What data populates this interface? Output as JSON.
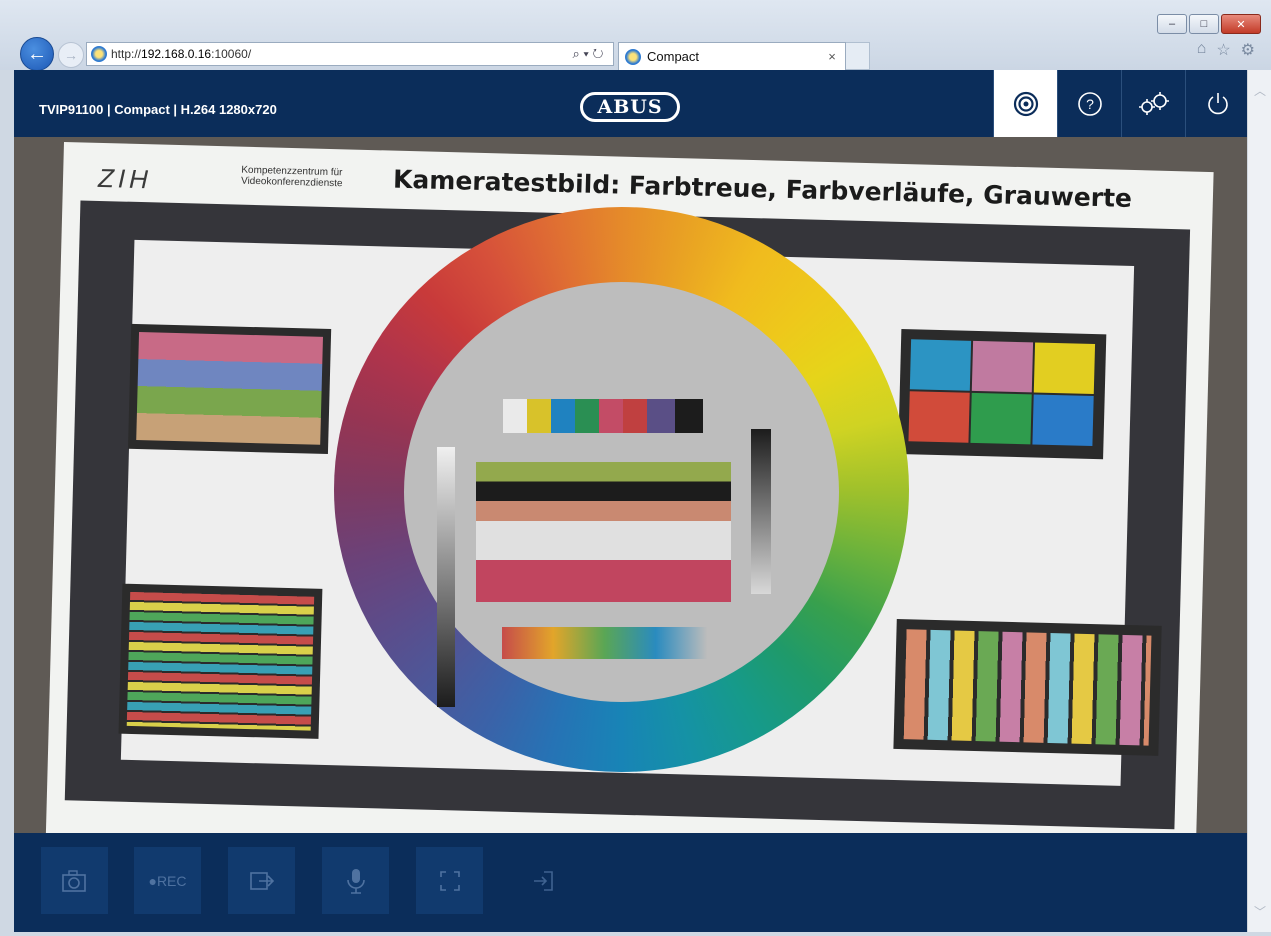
{
  "browser": {
    "url_prefix": "http://",
    "url_host": "192.168.0.16",
    "url_rest": ":10060/",
    "address_controls": "⌕ ▾ ↻",
    "tab_title": "Compact",
    "tab_close": "×",
    "toolbar_icons": [
      "home-icon",
      "star-icon",
      "gear-icon"
    ]
  },
  "header": {
    "camera_title": "TVIP91100 | Compact | H.264 1280x720",
    "logo_text": "ABUS",
    "buttons": [
      "live-view-icon",
      "help-icon",
      "settings-icon",
      "power-icon"
    ]
  },
  "video": {
    "chart_title": "Kameratestbild: Farbtreue, Farbverläufe, Grauwerte",
    "zih": "ZIH",
    "kompetenz_line1": "Kompetenzzentrum für",
    "kompetenz_line2": "Videokonferenzdienste"
  },
  "controls": {
    "rec_label": "●REC",
    "items": [
      "snapshot-icon",
      "record-icon",
      "export-icon",
      "microphone-icon",
      "fullscreen-icon",
      "login-icon"
    ]
  },
  "colors": {
    "header_bg": "#0b2d5a",
    "active_button_bg": "#ffffff",
    "control_bg": "#113a6e",
    "control_icon": "#4f72a0"
  }
}
